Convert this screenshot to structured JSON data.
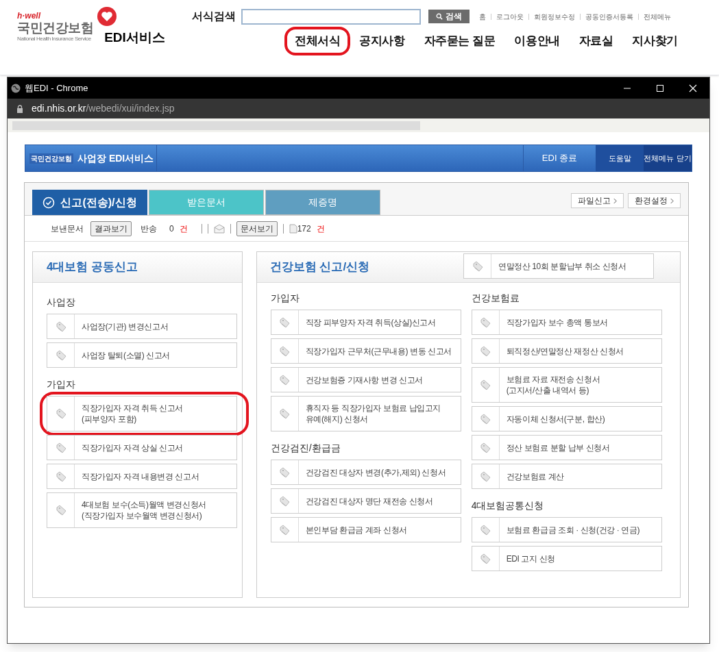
{
  "site": {
    "logo": {
      "brand": "h·well",
      "name": "국민건강보험",
      "subtitle": "National Health Insurance Service"
    },
    "service": "EDI서비스",
    "search": {
      "label": "서식검색",
      "button": "검색"
    },
    "util_links": [
      "홈",
      "로그아웃",
      "회원정보수정",
      "공동인증서등록",
      "전체메뉴"
    ],
    "nav": [
      {
        "label": "전체서식",
        "highlighted": true
      },
      {
        "label": "공지사항",
        "highlighted": false
      },
      {
        "label": "자주묻는 질문",
        "highlighted": false
      },
      {
        "label": "이용안내",
        "highlighted": false
      },
      {
        "label": "자료실",
        "highlighted": false
      },
      {
        "label": "지사찾기",
        "highlighted": false
      }
    ]
  },
  "popup": {
    "title": "웹EDI - Chrome",
    "url_host": "edi.nhis.or.kr",
    "url_path": "/webedi/xui/index.jsp"
  },
  "app_header": {
    "logo": "국민건강보험",
    "title": "사업장 EDI서비스",
    "buttons": [
      "EDI 종료",
      "도움말",
      "전체메뉴 닫기"
    ]
  },
  "tabs": [
    {
      "label": "신고(전송)/신청",
      "selected": true,
      "color": "#1f5fa6"
    },
    {
      "label": "받은문서",
      "selected": false,
      "color": "#4cc4c8"
    },
    {
      "label": "제증명",
      "selected": false,
      "color": "#5f9ec0"
    }
  ],
  "tab_actions": [
    "파일신고",
    "환경설정"
  ],
  "toolbar": {
    "sent_label": "보낸문서",
    "result_button": "결과보기",
    "returned_label": "반송",
    "returned_count": "0",
    "returned_unit": "건",
    "doc_button": "문서보기",
    "doc_count": "172",
    "doc_unit": "건"
  },
  "left_panel": {
    "title": "4대보험 공동신고",
    "groups": [
      {
        "title": "사업장",
        "items": [
          {
            "label": "사업장(기관) 변경신고서",
            "highlighted": false
          },
          {
            "label": "사업장 탈퇴(소멸) 신고서",
            "highlighted": false
          }
        ]
      },
      {
        "title": "가입자",
        "items": [
          {
            "label": "직장가입자 자격 취득 신고서\n(피부양자 포함)",
            "highlighted": true
          },
          {
            "label": "직장가입자 자격 상실 신고서",
            "highlighted": false
          },
          {
            "label": "직장가입자 자격 내용변경 신고서",
            "highlighted": false
          },
          {
            "label": "4대보험 보수(소득)월액 변경신청서\n(직장가입자 보수월액 변경신청서)",
            "highlighted": false
          }
        ]
      }
    ]
  },
  "right_panel": {
    "title": "건강보험 신고/신청",
    "top_item": "연말정산 10회 분할납부 취소 신청서",
    "columns": [
      [
        {
          "title": "가입자",
          "items": [
            {
              "label": "직장 피부양자 자격 취득(상실)신고서",
              "highlighted": false
            },
            {
              "label": "직장가입자 근무처(근무내용) 변동 신고서",
              "highlighted": false
            },
            {
              "label": "건강보험증 기재사항 변경 신고서",
              "highlighted": false
            },
            {
              "label": "휴직자 등 직장가입자 보험료 납입고지\n유예(해지) 신청서",
              "highlighted": false
            }
          ]
        },
        {
          "title": "건강검진/환급금",
          "items": [
            {
              "label": "건강검진 대상자 변경(추가,제외) 신청서",
              "highlighted": false
            },
            {
              "label": "건강검진 대상자 명단 재전송 신청서",
              "highlighted": false
            },
            {
              "label": "본인부담 환급금 계좌 신청서",
              "highlighted": false
            }
          ]
        }
      ],
      [
        {
          "title": "건강보험료",
          "items": [
            {
              "label": "직장가입자 보수 총액 통보서",
              "highlighted": false
            },
            {
              "label": "퇴직정산/연말정산 재정산 신청서",
              "highlighted": false
            },
            {
              "label": "보험료 자료 재전송 신청서\n(고지서/산출 내역서 등)",
              "highlighted": false
            },
            {
              "label": "자동이체 신청서(구분, 합산)",
              "highlighted": false
            },
            {
              "label": "정산 보험료 분할 납부 신청서",
              "highlighted": false
            },
            {
              "label": "건강보험료 계산",
              "highlighted": false
            }
          ]
        },
        {
          "title": "4대보험공통신청",
          "items": [
            {
              "label": "보험료 환급금 조회 · 신청(건강 · 연금)",
              "highlighted": false
            },
            {
              "label": "EDI 고지 신청",
              "highlighted": false
            }
          ]
        }
      ]
    ]
  }
}
